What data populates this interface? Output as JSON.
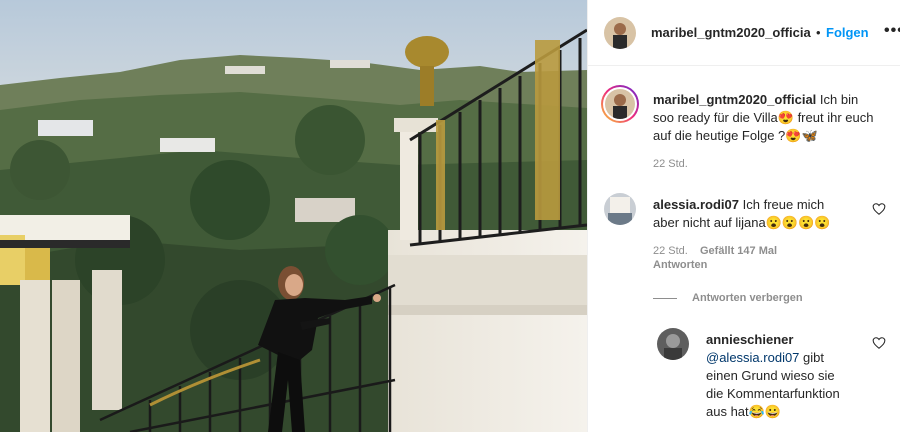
{
  "post": {
    "username": "maribel_gntm2020_officia",
    "dot": "•",
    "follow_label": "Folgen",
    "more_icon": "•••"
  },
  "caption": {
    "username": "maribel_gntm2020_official",
    "text_line1": "Ich bin",
    "text_line2": "soo ready für die Villa😍 freut ihr euch",
    "text_line3": "auf die heutige Folge ?😍🦋",
    "time": "22 Std."
  },
  "comments": [
    {
      "username": "alessia.rodi07",
      "text_line1": "Ich freue mich",
      "text_line2": "aber nicht auf lijana😮😮😮😮",
      "time": "22 Std.",
      "likes": "Gefällt 147 Mal",
      "reply_label": "Antworten",
      "hide_replies_label": "Antworten verbergen"
    }
  ],
  "reply": {
    "username": "annieschiener",
    "mention": "@alessia.rodi07",
    "text_line1": "gibt",
    "text_line2": "einen Grund wieso sie",
    "text_line3": "die Kommentarfunktion",
    "text_line4": "aus hat😂😀"
  },
  "icons": {
    "heart": "heart-outline-icon",
    "more": "more-horizontal-icon"
  },
  "colors": {
    "accent": "#0095f6",
    "text": "#262626",
    "muted": "#8e8e8e",
    "mention": "#00376b"
  }
}
